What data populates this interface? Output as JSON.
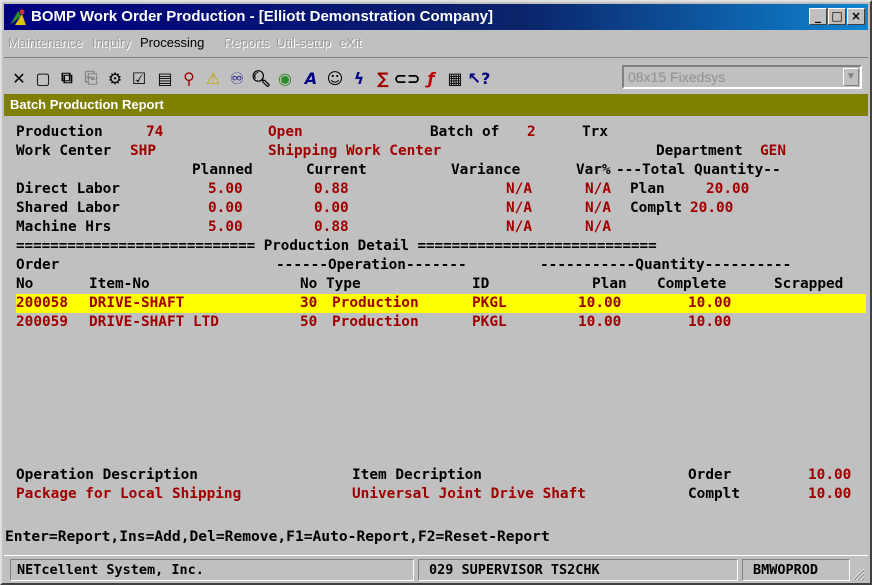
{
  "window": {
    "title": "BOMP Work Order Production - [Elliott Demonstration Company]",
    "controls": {
      "minimize": "_",
      "maximize": "□",
      "close": "×"
    }
  },
  "menu": [
    {
      "label": "Maintenance",
      "enabled": false
    },
    {
      "label": "Inquiry",
      "enabled": false
    },
    {
      "label": "Processing",
      "enabled": true
    },
    {
      "label": "Reports",
      "enabled": false
    },
    {
      "label": "Util-setup",
      "enabled": false
    },
    {
      "label": "eXit",
      "enabled": false
    }
  ],
  "toolbar": {
    "icons": [
      "close-x-icon",
      "window-icon",
      "copy-icon",
      "paste-icon",
      "settings-icon",
      "properties-icon",
      "list-icon",
      "find-icon",
      "warning-icon",
      "binoculars-icon",
      "magnifier-icon",
      "globe-icon",
      "font-icon",
      "people-icon",
      "lightning-icon",
      "formula-icon",
      "link-icon",
      "function-icon",
      "notes-icon",
      "help-pointer-icon"
    ],
    "font_select": "08x15 Fixedsys"
  },
  "app_title": "Batch Production Report",
  "header": {
    "production_label": "Production",
    "production_value": "74",
    "status": "Open",
    "batch_label": "Batch of",
    "batch_value": "2",
    "batch_suffix": "Trx",
    "work_center_label": "Work Center",
    "work_center_code": "SHP",
    "work_center_name": "Shipping Work Center",
    "department_label": "Department",
    "department_value": "GEN"
  },
  "labor": {
    "headers": [
      "Planned",
      "Current",
      "Variance",
      "Var%"
    ],
    "total_header": "---Total Quantity--",
    "rows": [
      {
        "label": "Direct Labor",
        "planned": "5.00",
        "current": "0.88",
        "variance": "N/A",
        "var_pct": "N/A",
        "total_label": "Plan",
        "total_value": "20.00"
      },
      {
        "label": "Shared Labor",
        "planned": "0.00",
        "current": "0.00",
        "variance": "N/A",
        "var_pct": "N/A",
        "total_label": "Complt",
        "total_value": "20.00"
      },
      {
        "label": "Machine Hrs",
        "planned": "5.00",
        "current": "0.88",
        "variance": "N/A",
        "var_pct": "N/A",
        "total_label": "",
        "total_value": ""
      }
    ]
  },
  "detail": {
    "separator": "============================ Production Detail ============================",
    "group_line": {
      "order": "Order",
      "operation": "------Operation-------",
      "quantity": "-----------Quantity----------"
    },
    "columns": {
      "no": "No",
      "item_no": "Item-No",
      "op_no_type": "No Type",
      "id": "ID",
      "plan": "Plan",
      "complete": "Complete",
      "scrapped": "Scrapped"
    },
    "rows": [
      {
        "order": "200058",
        "item": "DRIVE-SHAFT",
        "op_no": "30",
        "op_type": "Production",
        "id": "PKGL",
        "plan": "10.00",
        "complete": "10.00",
        "scrapped": "",
        "selected": true
      },
      {
        "order": "200059",
        "item": "DRIVE-SHAFT LTD",
        "op_no": "50",
        "op_type": "Production",
        "id": "PKGL",
        "plan": "10.00",
        "complete": "10.00",
        "scrapped": "",
        "selected": false
      }
    ]
  },
  "footer": {
    "op_desc_label": "Operation Description",
    "op_desc_value": "Package for Local Shipping",
    "item_desc_label": "Item Decription",
    "item_desc_value": "Universal Joint Drive Shaft",
    "order_label": "Order",
    "order_value": "10.00",
    "complt_label": "Complt",
    "complt_value": "10.00"
  },
  "hint": "Enter=Report,Ins=Add,Del=Remove,F1=Auto-Report,F2=Reset-Report",
  "status": {
    "company": "NETcellent System, Inc.",
    "session": "029 SUPERVISOR TS2CHK",
    "program": "BMWOPROD"
  },
  "colors": {
    "title_bar": "#000080",
    "app_title_bar": "#808000",
    "highlight_row": "#ffff00",
    "value_red": "#a00000",
    "screen_bg": "#c0c0c0"
  }
}
